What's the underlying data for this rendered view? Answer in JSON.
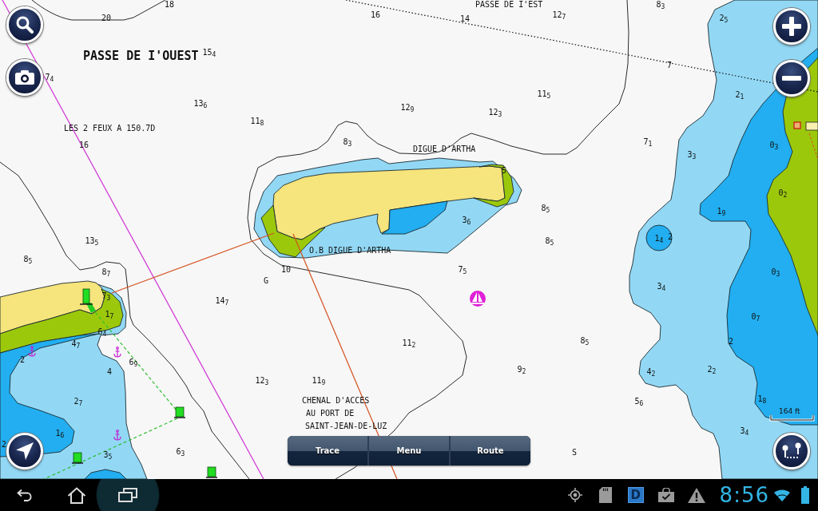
{
  "map": {
    "labels": [
      {
        "text": "PASSE DE I'EST",
        "kind": "note"
      },
      {
        "text": "PASSE DE I'OUEST",
        "kind": "name"
      },
      {
        "text": "LES 2 FEUX A 150.7D",
        "kind": "note"
      },
      {
        "text": "DIGUE D'ARTHA",
        "kind": "note"
      },
      {
        "text": "O.B DIGUE D'ARTHA",
        "kind": "note"
      },
      {
        "text": "G",
        "kind": "seabed"
      },
      {
        "text": "CHENAL D'ACCES",
        "kind": "note"
      },
      {
        "text": "AU PORT DE",
        "kind": "note"
      },
      {
        "text": "SAINT-JEAN-DE-LUZ",
        "kind": "note"
      },
      {
        "text": "S",
        "kind": "seabed"
      }
    ],
    "soundings": [
      "18",
      "8$_{3}$",
      "20",
      "16",
      "14",
      "12$_{7}$",
      "2$_{5}$",
      "15$_{4}$",
      "7",
      "7$_{4}$",
      "11$_{5}$",
      "2$_{1}$",
      "13$_{6}$",
      "12$_{9}$",
      "12$_{3}$",
      "11$_{8}$",
      "16",
      "8$_{3}$",
      "7$_{1}$",
      "0$_{3}$",
      "3$_{3}$",
      "5",
      "0$_{2}$",
      "8$_{5}$",
      "1$_{9}$",
      "3$_{6}$",
      "13$_{5}$",
      "8$_{5}$",
      "1$_{4}$",
      "2",
      "8$_{5}$",
      "8$_{7}$",
      "10",
      "7$_{5}$",
      "0$_{3}$",
      "3$_{4}$",
      "7$_{3}$",
      "14$_{7}$",
      "1$_{7}$",
      "0$_{7}$",
      "6$_{4}$",
      "4$_{7}$",
      "11$_{2}$",
      "8$_{5}$",
      "2",
      "2",
      "6$_{9}$",
      "4",
      "9$_{2}$",
      "4$_{2}$",
      "2$_{2}$",
      "12$_{3}$",
      "11$_{9}$",
      "2$_{7}$",
      "5$_{6}$",
      "1$_{8}$",
      "1$_{6}$",
      "3$_{4}$",
      "2",
      "3$_{5}$",
      "6$_{3}$"
    ]
  },
  "scale_bar": {
    "label": "164 ft"
  },
  "bottom_menu": [
    {
      "label": "Trace"
    },
    {
      "label": "Menu"
    },
    {
      "label": "Route"
    }
  ],
  "nav_buttons": [
    {
      "pressed": false
    },
    {
      "pressed": false
    },
    {
      "pressed": true
    }
  ],
  "status_bar": {
    "app_icon_label": "D",
    "time": "8:56"
  }
}
